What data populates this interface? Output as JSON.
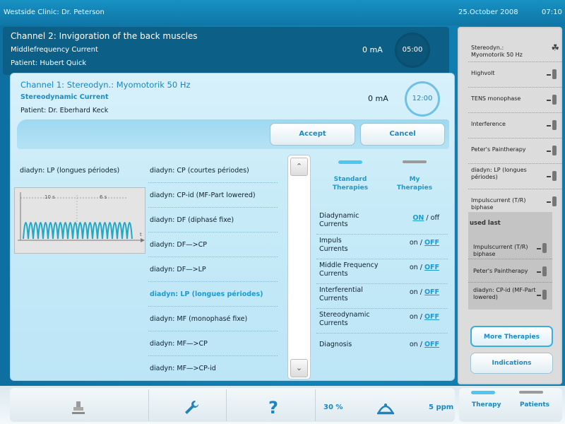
{
  "header": {
    "clinic": "Westside Clinic: Dr. Peterson",
    "date": "25.October 2008",
    "time": "07:10"
  },
  "channel2": {
    "title": "Channel 2: Invigoration of the back muscles",
    "current": "Middlefrequency Current",
    "patient": "Patient: Hubert Quick",
    "ma": "0 mA",
    "timer": "05:00"
  },
  "channel1": {
    "title": "Channel 1: Stereodyn.: Myomotorik 50 Hz",
    "current": "Stereodynamic Current",
    "patient": "Patient: Dr. Eberhard Keck",
    "ma": "0 mA",
    "timer": "12:00"
  },
  "actions": {
    "accept": "Accept",
    "cancel": "Cancel"
  },
  "selected_program": "diadyn: LP (longues périodes)",
  "preview": {
    "label1": "10 s",
    "label2": "6 s",
    "axis": "t"
  },
  "programs": [
    "diadyn: CP (courtes périodes)",
    "diadyn: CP-id (MF-Part lowered)",
    "diadyn: DF (diphasé fixe)",
    "diadyn: DF—>CP",
    "diadyn: DF—>LP",
    "diadyn: LP (longues périodes)",
    "diadyn: MF (monophasé fixe)",
    "diadyn: MF—>CP",
    "diadyn: MF—>CP-id"
  ],
  "tabs": {
    "standard": "Standard\nTherapies",
    "my": "My\nTherapies"
  },
  "therapies": [
    {
      "name": "Diadynamic\nCurrents",
      "on": "ON",
      "sep": " / ",
      "off": "off",
      "active": "on"
    },
    {
      "name": "Impuls\nCurrents",
      "on": "on",
      "sep": " / ",
      "off": "OFF",
      "active": "off"
    },
    {
      "name": "Middle Frequency\nCurrents",
      "on": "on",
      "sep": " / ",
      "off": "OFF",
      "active": "off"
    },
    {
      "name": "Interferential\nCurrents",
      "on": "on",
      "sep": " / ",
      "off": "OFF",
      "active": "off"
    },
    {
      "name": "Stereodynamic\nCurrents",
      "on": "on",
      "sep": " / ",
      "off": "OFF",
      "active": "off"
    },
    {
      "name": "Diagnosis",
      "on": "on",
      "sep": " / ",
      "off": "OFF",
      "active": "off"
    }
  ],
  "sidebar": {
    "items": [
      "Stereodyn.: Myomotorik 50 Hz",
      "Highvolt",
      "TENS monophase",
      "Interference",
      "Peter's Paintherapy",
      "diadyn: LP (longues périodes)",
      "Impulscurrent (T/R) biphase"
    ],
    "used_last_title": "used last",
    "used_last": [
      "Impulscurrent (T/R) biphase",
      "Peter's Paintherapy",
      "diadyn: CP-id (MF-Part lowered)"
    ],
    "more": "More Therapies",
    "indications": "Indications"
  },
  "bottom": {
    "percent": "30 %",
    "ppm": "5 ppm",
    "therapy": "Therapy",
    "patients": "Patients"
  },
  "colors": {
    "accent": "#1c9ad3",
    "header": "#0f76a6"
  }
}
